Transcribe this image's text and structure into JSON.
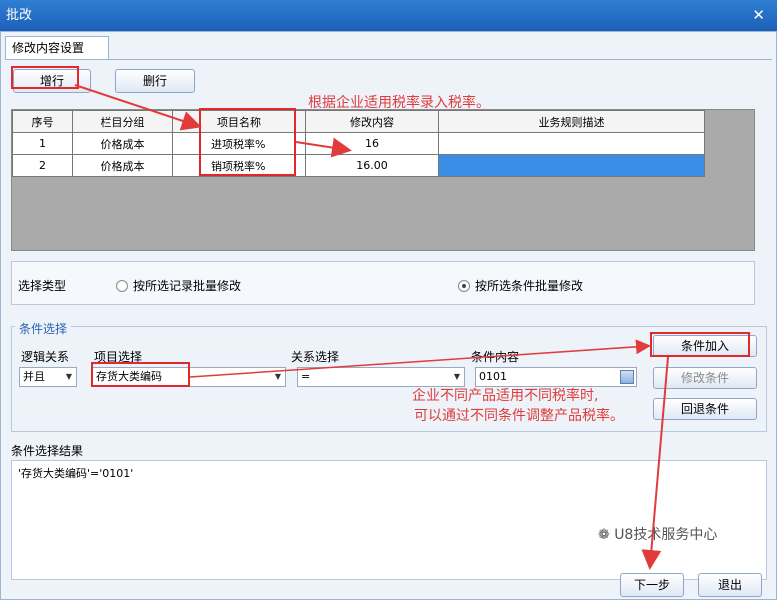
{
  "window": {
    "title": "批改",
    "close_glyph": "✕"
  },
  "tab": {
    "label": "修改内容设置"
  },
  "toolbar": {
    "add_row": "增行",
    "delete_row": "删行"
  },
  "grid": {
    "headers": [
      "序号",
      "栏目分组",
      "项目名称",
      "修改内容",
      "业务规则描述"
    ],
    "rows": [
      {
        "seq": "1",
        "group": "价格成本",
        "item": "进项税率%",
        "value": "16",
        "desc": ""
      },
      {
        "seq": "2",
        "group": "价格成本",
        "item": "销项税率%",
        "value": "16.00",
        "desc": ""
      }
    ]
  },
  "select_type": {
    "label": "选择类型",
    "option1": "按所选记录批量修改",
    "option2": "按所选条件批量修改",
    "selected": "option2"
  },
  "conditions": {
    "section_label": "条件选择",
    "logic_label": "逻辑关系",
    "logic_value": "并且",
    "item_label": "项目选择",
    "item_value": "存货大类编码",
    "relation_label": "关系选择",
    "relation_value": "=",
    "content_label": "条件内容",
    "content_value": "0101",
    "add_button": "条件加入",
    "modify_button": "修改条件",
    "back_button": "回退条件"
  },
  "result": {
    "label": "条件选择结果",
    "text": "'存货大类编码'='0101'"
  },
  "footer": {
    "next": "下一步",
    "exit": "退出"
  },
  "annotations": {
    "note1": "根据企业适用税率录入税率。",
    "note2_line1": "企业不同产品适用不同税率时,",
    "note2_line2": "可以通过不同条件调整产品税率。",
    "watermark": "U8技术服务中心"
  },
  "colors": {
    "annotation": "#e03c3c",
    "title_bar": "#1c5fb8",
    "selection": "#3a8ee6"
  }
}
